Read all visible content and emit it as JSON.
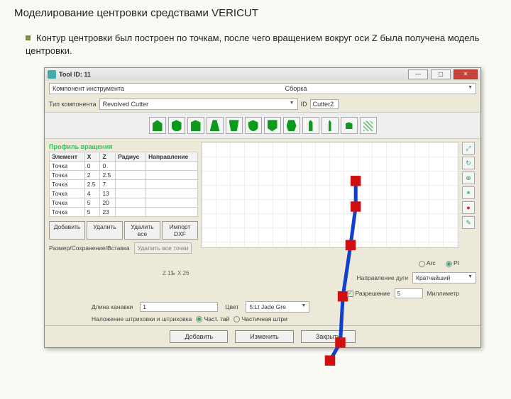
{
  "slide": {
    "title": "Моделирование центровки средствами VERICUT",
    "body": "Контур центровки был построен по точкам, после чего вращением вокруг оси Z была получена модель центровки."
  },
  "window": {
    "icon": "vericut-icon",
    "title": "Tool ID: 11",
    "close": "✕",
    "min": "—",
    "max": "▢"
  },
  "topcombo": {
    "label": "Компонент инструмента",
    "value": "Сборка"
  },
  "comprow": {
    "label": "Тип компонента",
    "value": "Revolved Cutter",
    "idlabel": "ID",
    "idvalue": "Cutter2"
  },
  "tools": [
    "t1",
    "t2",
    "t3",
    "t4",
    "t5",
    "t6",
    "t7",
    "t8",
    "t9",
    "t10",
    "t11",
    "t12"
  ],
  "section": "Профиль вращения",
  "table": {
    "headers": [
      "Элемент",
      "X",
      "Z",
      "Радиус",
      "Направление"
    ],
    "rows": [
      [
        "Точка",
        "0",
        "0",
        "",
        ""
      ],
      [
        "Точка",
        "2",
        "2.5",
        "",
        ""
      ],
      [
        "Точка",
        "2.5",
        "7",
        "",
        ""
      ],
      [
        "Точка",
        "4",
        "13",
        "",
        ""
      ],
      [
        "Точка",
        "5",
        "20",
        "",
        ""
      ],
      [
        "Точка",
        "5",
        "23",
        "",
        ""
      ]
    ]
  },
  "tblbtns": [
    "Добавить",
    "Удалить",
    "Удалить все",
    "Импорт DXF"
  ],
  "resrow": {
    "label": "Размер/Сохранение/Вставка",
    "btn": "Удалить все точки"
  },
  "sidetools": [
    "⤢",
    "↻",
    "⊕",
    "✶",
    "●",
    "✎"
  ],
  "radios": {
    "arc": "Arc",
    "pi": "PI"
  },
  "axis": {
    "z": "Z   11",
    "x": "X   26"
  },
  "dirrow": {
    "label": "Направление дуги",
    "value": "Кратчайший"
  },
  "resolrow": {
    "label": "Разрешение",
    "value": "5",
    "unit": "Миллиметр"
  },
  "lenrow": {
    "label": "Длина канавки",
    "value": "1",
    "colorlabel": "Цвет",
    "colorvalue": "5:Lt Jade Gre"
  },
  "shadow": {
    "label": "Наложение штриховки и штриховка",
    "opt1": "Част. тай",
    "opt2": "Частичная штри"
  },
  "footer": {
    "add": "Добавить",
    "modify": "Изменить",
    "close": "Закрыть"
  }
}
